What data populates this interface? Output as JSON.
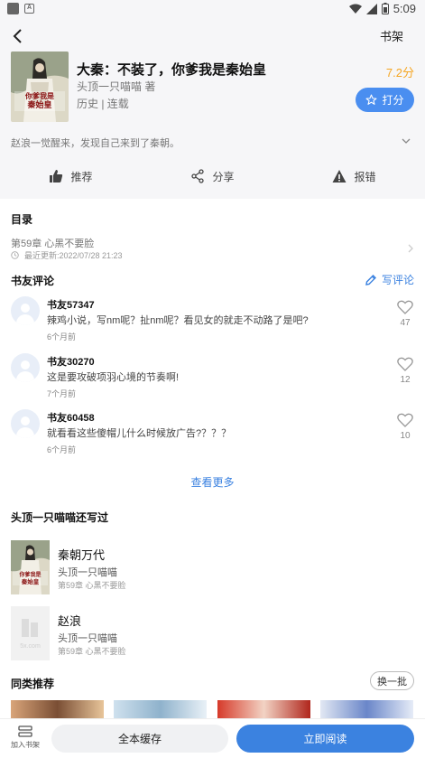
{
  "status_bar": {
    "time": "5:09",
    "notif_icon_letter": "A"
  },
  "nav": {
    "shelf_label": "书架"
  },
  "book": {
    "title": "大秦：不装了，你爹我是秦始皇",
    "score": "7.2分",
    "author": "头顶一只喵喵 著",
    "genre": "历史 | 连载",
    "rate_label": "打分",
    "intro": "赵浪一觉醒来，发现自己来到了秦朝。",
    "cover_text": "不装了，你爹我是秦始皇"
  },
  "actions": [
    {
      "label": "推荐",
      "icon": "thumbs-up-icon"
    },
    {
      "label": "分享",
      "icon": "share-icon"
    },
    {
      "label": "报错",
      "icon": "warning-icon"
    }
  ],
  "toc": {
    "title": "目录",
    "latest_chapter": "第59章 心黑不要脸",
    "updated": "最近更新:2022/07/28 21:23"
  },
  "reviews_section": {
    "title": "书友评论",
    "write_label": "写评论",
    "more_label": "查看更多",
    "items": [
      {
        "user": "书友57347",
        "text": "辣鸡小说，写nm呢？扯nm呢？看见女的就走不动路了是吧?",
        "time": "6个月前",
        "likes": "47"
      },
      {
        "user": "书友30270",
        "text": "这是要攻破项羽心境的节奏啊!",
        "time": "7个月前",
        "likes": "12"
      },
      {
        "user": "书友60458",
        "text": "就看看这些傻帽儿什么时候放广告?？？？",
        "time": "6个月前",
        "likes": "10"
      }
    ]
  },
  "author_books": {
    "title": "头顶一只喵喵还写过",
    "items": [
      {
        "title": "秦朝万代",
        "author": "头顶一只喵喵",
        "chapter": "第59章 心黑不要脸"
      },
      {
        "title": "赵浪",
        "author": "头顶一只喵喵",
        "chapter": "第59章 心黑不要脸",
        "placeholder_text": "5x.com"
      }
    ]
  },
  "similar": {
    "title": "同类推荐",
    "swap_label": "换一批"
  },
  "bottom": {
    "add_shelf_label": "加入书架",
    "cache_label": "全本缓存",
    "read_label": "立即阅读"
  },
  "colors": {
    "accent": "#3b82e0",
    "score": "#f5a623",
    "header_bg": "#f6f6f8"
  }
}
